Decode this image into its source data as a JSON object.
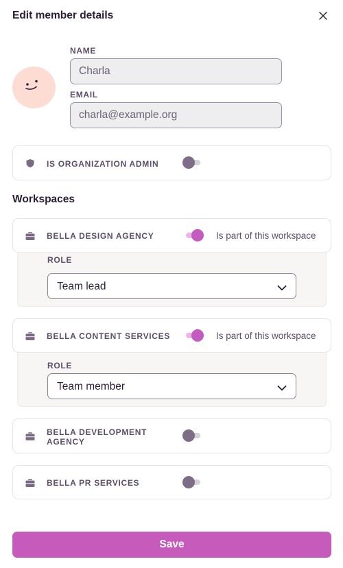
{
  "dialog": {
    "title": "Edit member details"
  },
  "member": {
    "name_label": "NAME",
    "name_value": "Charla",
    "email_label": "EMAIL",
    "email_value": "charla@example.org"
  },
  "admin": {
    "label": "IS ORGANIZATION ADMIN",
    "enabled": false
  },
  "workspaces": {
    "title": "Workspaces",
    "member_text": "Is part of this workspace",
    "role_label": "ROLE",
    "items": [
      {
        "name": "BELLA DESIGN AGENCY",
        "member": true,
        "role": "Team lead"
      },
      {
        "name": "BELLA CONTENT SERVICES",
        "member": true,
        "role": "Team member"
      },
      {
        "name_line1": "BELLA DEVELOPMENT",
        "name_line2": "AGENCY",
        "member": false
      },
      {
        "name": "BELLA PR SERVICES",
        "member": false
      }
    ]
  },
  "footer": {
    "save_label": "Save"
  },
  "colors": {
    "accent": "#c75bbb",
    "toggle_on": "#c45bc0",
    "toggle_off": "#7d6d86",
    "avatar_bg": "#fdddd3"
  },
  "icons": [
    "close-icon",
    "smiley-face-icon",
    "shield-icon",
    "briefcase-icon",
    "chevron-down-icon"
  ]
}
